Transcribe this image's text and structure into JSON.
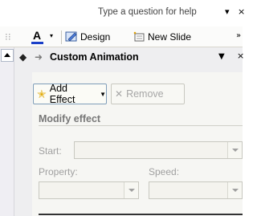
{
  "menubar": {
    "help_placeholder": "Type a question for help"
  },
  "toolbar": {
    "design_label": "Design",
    "new_slide_label": "New Slide"
  },
  "pane": {
    "title": "Custom Animation",
    "add_effect_label": "Add Effect",
    "remove_label": "Remove",
    "modify_title": "Modify effect",
    "start_label": "Start:",
    "property_label": "Property:",
    "speed_label": "Speed:"
  },
  "colors": {
    "font_color_bar": "#1a3fc8",
    "add_effect_star": "#e0a800",
    "disabled_text": "#a0a0a0"
  },
  "icons": [
    "grip-icon",
    "font-color-icon",
    "design-icon",
    "new-slide-icon",
    "back-arrow-icon",
    "forward-arrow-icon",
    "add-effect-star-icon",
    "remove-icon"
  ]
}
